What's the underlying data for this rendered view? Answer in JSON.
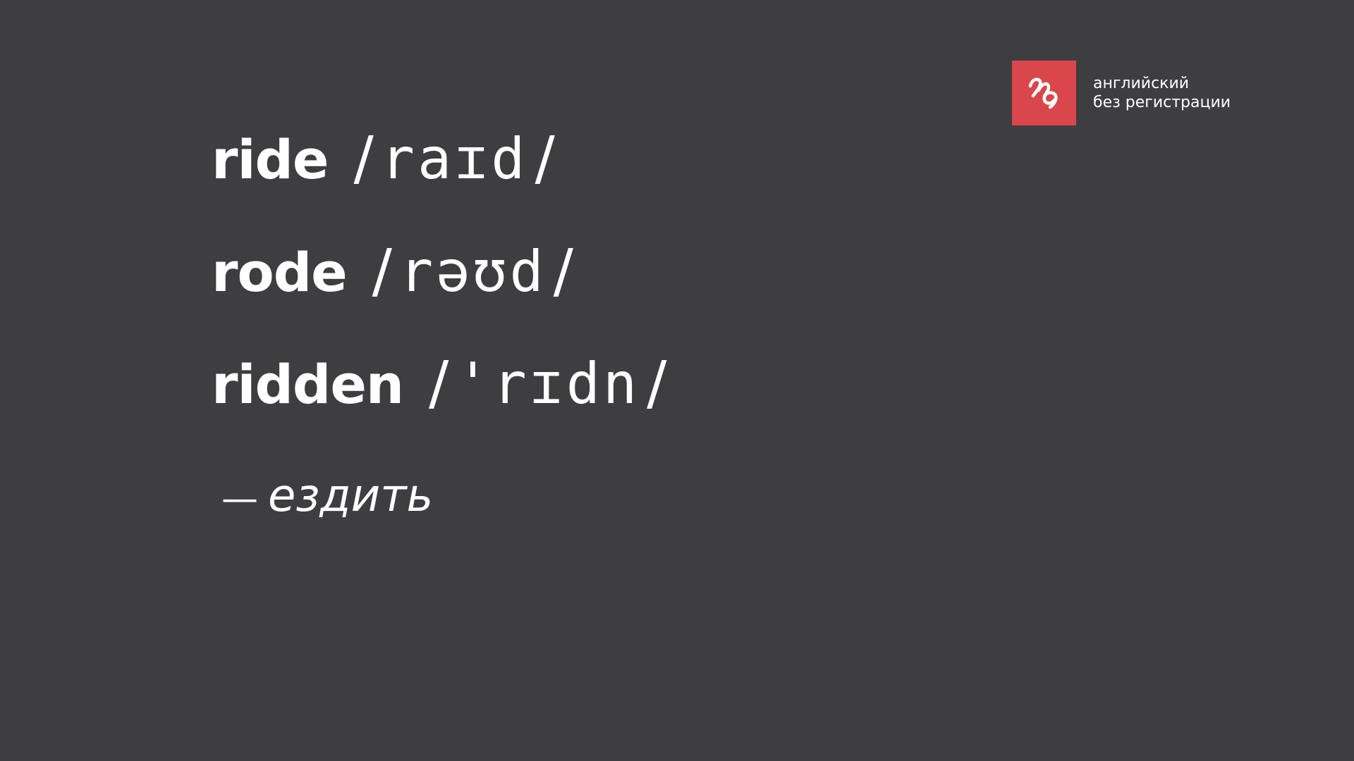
{
  "brand": {
    "line1": "английский",
    "line2": "без регистрации",
    "color": "#d9474b",
    "icon": "handwriting-squiggle-icon"
  },
  "forms": [
    {
      "word": "ride",
      "slash_open": "/",
      "ipa": "raɪd",
      "slash_close": "/"
    },
    {
      "word": "rode",
      "slash_open": "/",
      "ipa": "rəʊd",
      "slash_close": "/"
    },
    {
      "word": "ridden",
      "slash_open": "/",
      "ipa": "'rɪdn",
      "slash_close": "/"
    }
  ],
  "translation": {
    "dash": "—",
    "text": "ездить"
  },
  "colors": {
    "background": "#3e3d40",
    "text": "#ffffff"
  }
}
